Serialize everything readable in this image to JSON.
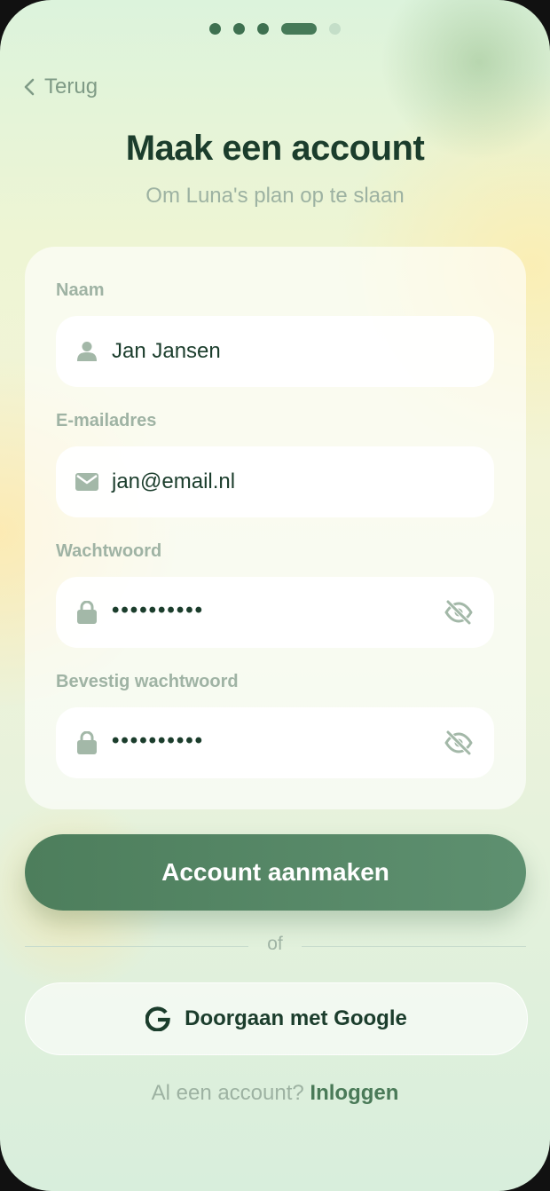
{
  "progress": {
    "total_steps": 5,
    "current_step": 4
  },
  "nav": {
    "back_label": "Terug"
  },
  "header": {
    "title": "Maak een account",
    "subtitle": "Om Luna's plan op te slaan"
  },
  "form": {
    "name": {
      "label": "Naam",
      "value": "Jan Jansen",
      "icon": "person-icon"
    },
    "email": {
      "label": "E-mailadres",
      "value": "jan@email.nl",
      "icon": "mail-icon"
    },
    "password": {
      "label": "Wachtwoord",
      "value": "••••••••••",
      "icon": "lock-icon",
      "toggle_icon": "eye-off-icon"
    },
    "confirm_password": {
      "label": "Bevestig wachtwoord",
      "value": "••••••••••",
      "icon": "lock-icon",
      "toggle_icon": "eye-off-icon"
    }
  },
  "actions": {
    "create_label": "Account aanmaken",
    "divider_label": "of",
    "google_label": "Doorgaan met Google"
  },
  "footer": {
    "prompt": "Al een account?",
    "login_label": "Inloggen"
  },
  "colors": {
    "primary": "#4d7e5c",
    "text_dark": "#1b3d2c",
    "muted": "#9fb3a4"
  }
}
